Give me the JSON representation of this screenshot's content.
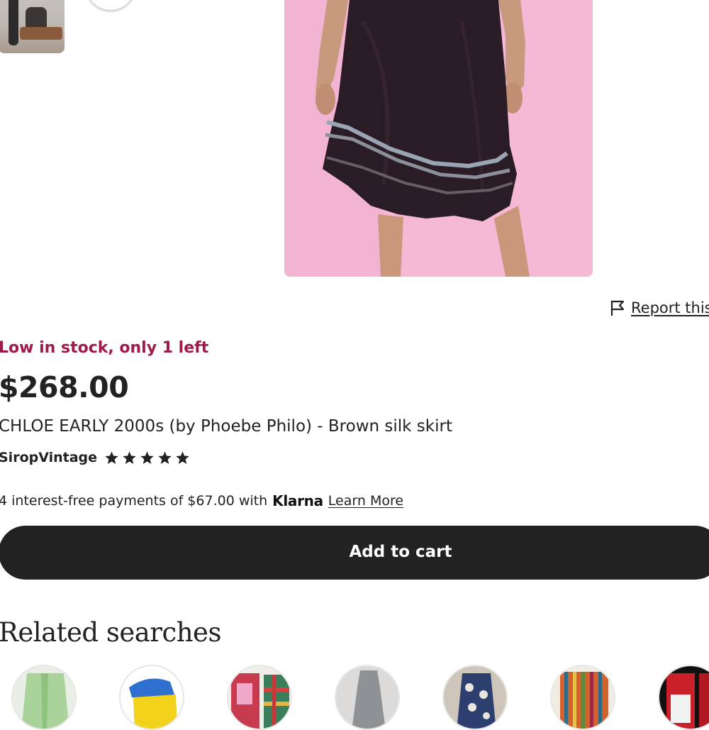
{
  "report": {
    "label": "Report this"
  },
  "stock": {
    "text": "Low in stock, only 1 left"
  },
  "price": {
    "value": "$268.00"
  },
  "product": {
    "title": "CHLOE EARLY 2000s (by Phoebe Philo) - Brown silk skirt"
  },
  "shop": {
    "name": "SiropVintage",
    "rating": 5,
    "star_icon": "star-icon"
  },
  "payments": {
    "text": "4 interest-free payments of $67.00 with",
    "brand": "Klarna",
    "link": "Learn More"
  },
  "cart": {
    "label": "Add to cart"
  },
  "related": {
    "heading": "Related searches",
    "items": [
      {
        "icon": "green-garment-thumbnail"
      },
      {
        "icon": "blue-yellow-shoe-thumbnail"
      },
      {
        "icon": "plaid-skirt-thumbnail"
      },
      {
        "icon": "grey-dress-thumbnail"
      },
      {
        "icon": "floral-dress-thumbnail"
      },
      {
        "icon": "striped-skirt-thumbnail"
      },
      {
        "icon": "red-product-thumbnail"
      }
    ]
  },
  "colors": {
    "stock_accent": "#9e1a4a",
    "button": "#222222",
    "photo_background": "#f4b6d5"
  }
}
